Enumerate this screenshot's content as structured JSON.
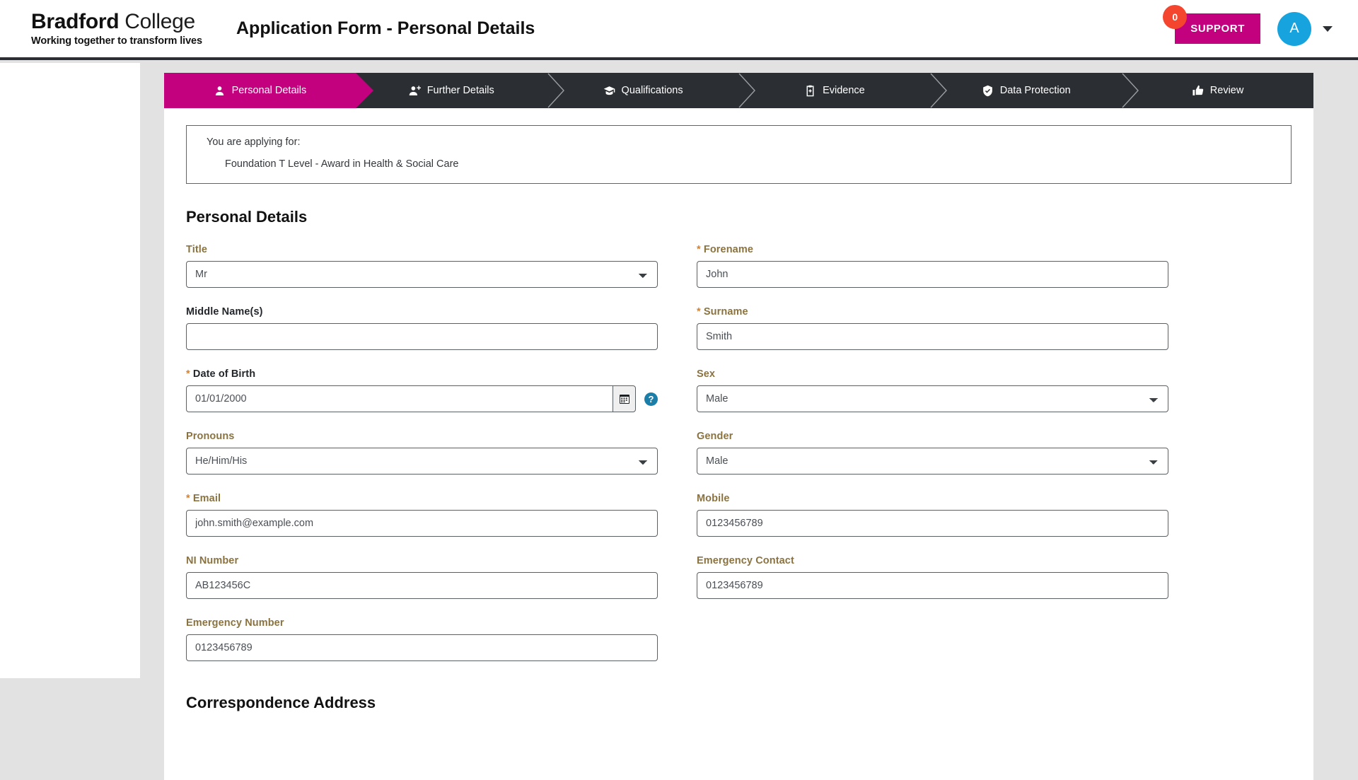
{
  "header": {
    "brand_bold": "Bradford",
    "brand_light": " College",
    "tagline": "Working together to transform lives",
    "page_title": "Application Form - Personal Details",
    "support_label": "SUPPORT",
    "support_badge": "0",
    "avatar_initial": "A",
    "accent_pink": "#c3017f",
    "badge_red": "#f4452e",
    "avatar_blue": "#17a3dd"
  },
  "stepper": {
    "steps": [
      {
        "label": "Personal Details",
        "icon": "person-icon",
        "active": true
      },
      {
        "label": "Further Details",
        "icon": "person-add-icon",
        "active": false
      },
      {
        "label": "Qualifications",
        "icon": "graduation-cap-icon",
        "active": false
      },
      {
        "label": "Evidence",
        "icon": "clipboard-plus-icon",
        "active": false
      },
      {
        "label": "Data Protection",
        "icon": "shield-check-icon",
        "active": false
      },
      {
        "label": "Review",
        "icon": "thumbs-up-icon",
        "active": false
      }
    ]
  },
  "applying": {
    "intro": "You are applying for:",
    "course": "Foundation T Level - Award in Health & Social Care",
    "border_color": "#1679bd"
  },
  "personal_details": {
    "heading": "Personal Details",
    "left": [
      {
        "label": "Title",
        "required": false,
        "label_style": "gold",
        "type": "select",
        "value": "Mr"
      },
      {
        "label": "Middle Name(s)",
        "required": false,
        "label_style": "dark",
        "type": "text",
        "value": ""
      },
      {
        "label": "Date of Birth",
        "required": true,
        "label_style": "dark",
        "type": "date",
        "value": "01/01/2000"
      },
      {
        "label": "Pronouns",
        "required": false,
        "label_style": "gold",
        "type": "select",
        "value": "He/Him/His"
      },
      {
        "label": "Email",
        "required": true,
        "label_style": "gold",
        "type": "text",
        "value": "john.smith@example.com"
      },
      {
        "label": "NI Number",
        "required": false,
        "label_style": "gold",
        "type": "text",
        "value": "AB123456C"
      },
      {
        "label": "Emergency Number",
        "required": false,
        "label_style": "gold",
        "type": "text",
        "value": "0123456789"
      }
    ],
    "right": [
      {
        "label": "Forename",
        "required": true,
        "label_style": "gold",
        "type": "text",
        "value": "John"
      },
      {
        "label": "Surname",
        "required": true,
        "label_style": "gold",
        "type": "text",
        "value": "Smith"
      },
      {
        "label": "Sex",
        "required": false,
        "label_style": "gold",
        "type": "select",
        "value": "Male"
      },
      {
        "label": "Gender",
        "required": false,
        "label_style": "gold",
        "type": "select",
        "value": "Male"
      },
      {
        "label": "Mobile",
        "required": false,
        "label_style": "gold",
        "type": "text",
        "value": "0123456789"
      },
      {
        "label": "Emergency Contact",
        "required": false,
        "label_style": "gold",
        "type": "text",
        "value": "0123456789"
      }
    ],
    "help_glyph": "?",
    "required_marker": "*"
  },
  "correspondence": {
    "heading": "Correspondence Address"
  }
}
